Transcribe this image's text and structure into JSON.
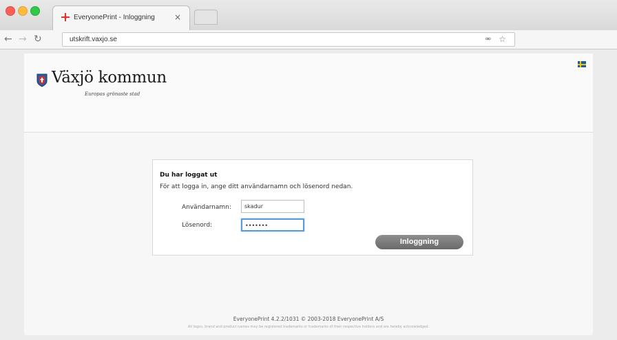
{
  "browser": {
    "tab_title": "EveryonePrint - Inloggning",
    "tab_close": "×",
    "url": "utskrift.vaxjo.se",
    "icons": [
      "back-icon",
      "forward-icon",
      "reload-icon",
      "key-icon",
      "star-icon"
    ]
  },
  "header": {
    "brand": "Växjö kommun",
    "tagline": "Europas grönaste stad"
  },
  "login": {
    "heading": "Du har loggat ut",
    "instructions": "För att logga in, ange ditt användarnamn och lösenord nedan.",
    "username_label": "Användarnamn:",
    "username_value": "skadur",
    "password_label": "Lösenord:",
    "password_value": "•••••••",
    "button_label": "Inloggning"
  },
  "footer": {
    "main": "EveryonePrint 4.2.2/1031 © 2003-2018 EveryonePrint A/S",
    "legal": "All logos, brand and product names may be registered trademarks or trademarks of their respective holders and are hereby acknowledged."
  },
  "colors": {
    "accent_focus": "#5b9bd5",
    "button": "#7a7a7a",
    "flag_blue": "#1b5ca8",
    "flag_yellow": "#f5c400"
  }
}
